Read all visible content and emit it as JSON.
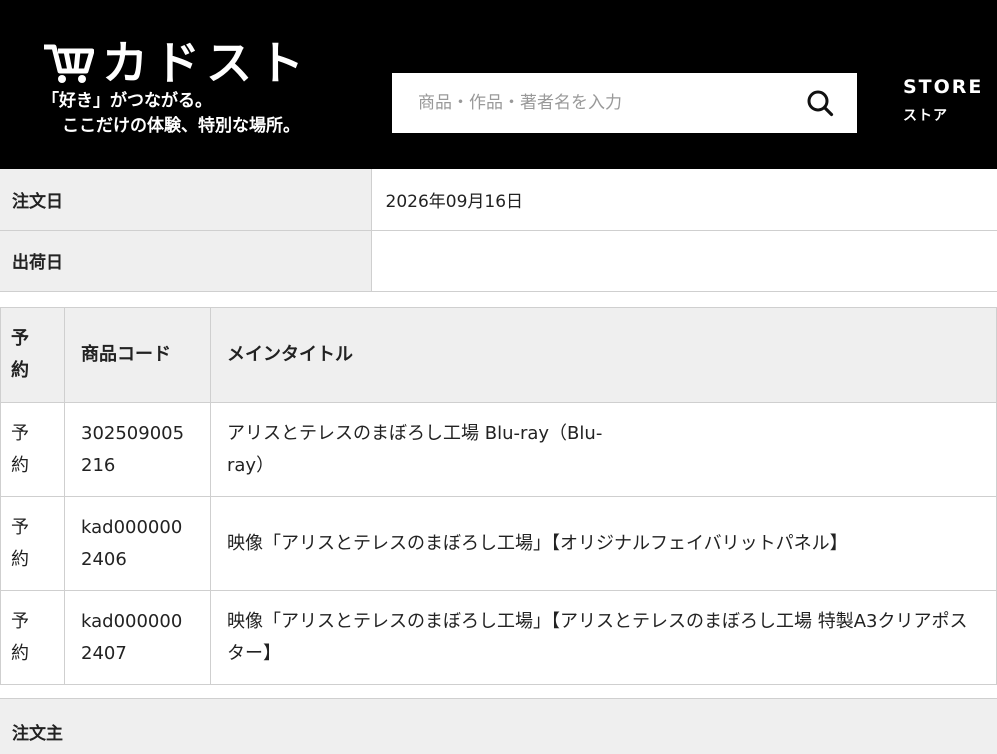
{
  "header": {
    "logo_text": "カドスト",
    "tagline_line1": "「好き」がつながる。",
    "tagline_line2": "ここだけの体験、特別な場所。",
    "search": {
      "placeholder": "商品・作品・著者名を入力",
      "value": ""
    },
    "store_label_en": "STORE",
    "store_label_jp": "ストア"
  },
  "order_info": [
    {
      "label": "注文日",
      "value": "2026年09月16日"
    },
    {
      "label": "出荷日",
      "value": ""
    }
  ],
  "items_table": {
    "headers": [
      "予約",
      "商品コード",
      "メインタイトル"
    ],
    "rows": [
      {
        "reserve": "予約",
        "code": "302509005216",
        "title": "アリスとテレスのまぼろし工場 Blu-ray（Blu-ray）"
      },
      {
        "reserve": "予約",
        "code": "kad0000002406",
        "title": "映像「アリスとテレスのまぼろし工場」【オリジナルフェイバリットパネル】"
      },
      {
        "reserve": "予約",
        "code": "kad0000002407",
        "title": "映像「アリスとテレスのまぼろし工場」【アリスとテレスのまぼろし工場 特製A3クリアポスター】"
      }
    ]
  },
  "orderer_section": {
    "label": "注文主"
  },
  "icons": {
    "search": "search-icon",
    "cart": "cart-logo-icon"
  },
  "colors": {
    "header_bg": "#000000",
    "cell_bg": "#efefef",
    "border": "#cfcfcf"
  }
}
